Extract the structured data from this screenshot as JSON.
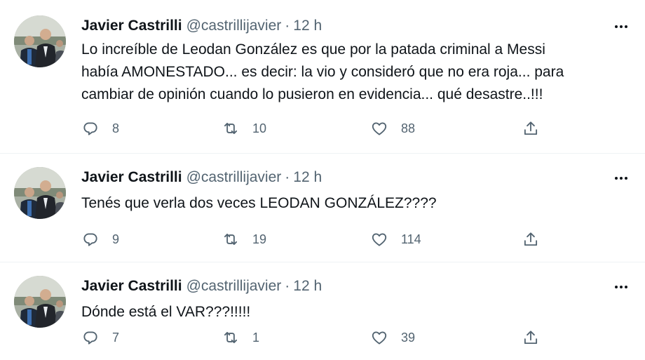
{
  "tweets": [
    {
      "author": "Javier Castrilli",
      "handle": "@castrillijavier",
      "separator": "·",
      "time": "12 h",
      "text": "Lo increíble de Leodan González es que por la patada criminal a Messi\nhabía AMONESTADO... es decir: la vio y consideró que no era roja... para\ncambiar de opinión cuando lo pusieron en evidencia... qué desastre..!!!",
      "replies": "8",
      "retweets": "10",
      "likes": "88"
    },
    {
      "author": "Javier Castrilli",
      "handle": "@castrillijavier",
      "separator": "·",
      "time": "12 h",
      "text": "Tenés que verla dos veces LEODAN GONZÁLEZ????",
      "replies": "9",
      "retweets": "19",
      "likes": "114"
    },
    {
      "author": "Javier Castrilli",
      "handle": "@castrillijavier",
      "separator": "·",
      "time": "12 h",
      "text": "Dónde está el VAR???!!!!!",
      "replies": "7",
      "retweets": "1",
      "likes": "39"
    }
  ],
  "icons": {
    "more": "more-horizontal-icon",
    "reply": "reply-icon",
    "retweet": "retweet-icon",
    "like": "heart-icon",
    "share": "share-icon"
  },
  "colors": {
    "text": "#0f1419",
    "secondary": "#536471",
    "divider": "#eff3f4"
  }
}
